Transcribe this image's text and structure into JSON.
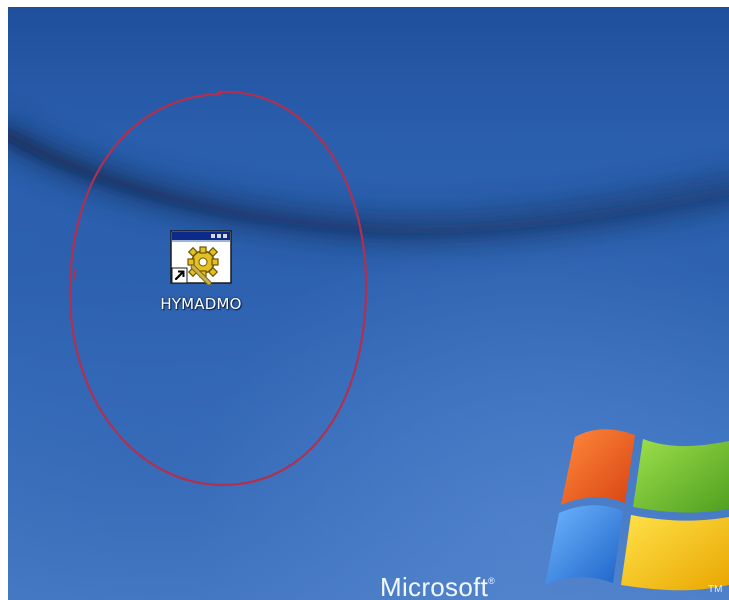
{
  "desktop": {
    "icons": [
      {
        "label": "HYMADMO",
        "icon": "application-gear-shortcut-icon"
      }
    ],
    "annotation": {
      "shape": "ellipse",
      "color": "#b03050"
    }
  },
  "wallpaper": {
    "brand": "Microsoft",
    "registered_mark": "®",
    "trademark": "TM",
    "logo": "windows-flag-logo"
  },
  "colors": {
    "desktop_blue": "#2d62b0",
    "annotation_red": "#b03050",
    "logo_red": "#e8581c",
    "logo_green": "#6cbf2c",
    "logo_blue": "#2f86e0",
    "logo_yellow": "#f7c600"
  }
}
